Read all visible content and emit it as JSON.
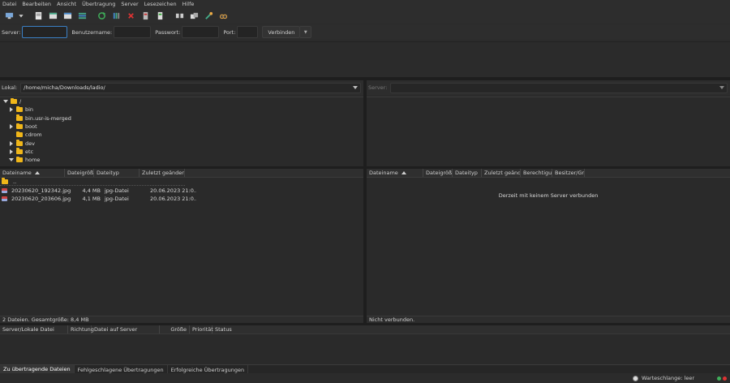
{
  "menu": [
    "Datei",
    "Bearbeiten",
    "Ansicht",
    "Übertragung",
    "Server",
    "Lesezeichen",
    "Hilfe"
  ],
  "toolbar_icons": [
    "site-manager-icon",
    "dropdown-arrow-icon",
    "toggle-log-icon",
    "toggle-local-tree-icon",
    "toggle-remote-tree-icon",
    "toggle-queue-icon",
    "refresh-icon",
    "process-queue-icon",
    "cancel-icon",
    "disconnect-icon",
    "reconnect-icon",
    "directory-compare-icon",
    "sync-browse-icon",
    "filter-icon",
    "search-icon"
  ],
  "quickconnect": {
    "server_label": "Server:",
    "server_value": "",
    "user_label": "Benutzername:",
    "user_value": "",
    "pass_label": "Passwort:",
    "pass_value": "",
    "port_label": "Port:",
    "port_value": "",
    "connect_label": "Verbinden"
  },
  "local": {
    "label": "Lokal:",
    "path": "/home/micha/Downloads/ladio/",
    "tree": [
      {
        "name": "/",
        "level": 0,
        "state": "expanded"
      },
      {
        "name": "bin",
        "level": 1,
        "state": "collapsed"
      },
      {
        "name": "bin.usr-is-merged",
        "level": 1,
        "state": "none"
      },
      {
        "name": "boot",
        "level": 1,
        "state": "collapsed"
      },
      {
        "name": "cdrom",
        "level": 1,
        "state": "none"
      },
      {
        "name": "dev",
        "level": 1,
        "state": "collapsed"
      },
      {
        "name": "etc",
        "level": 1,
        "state": "collapsed"
      },
      {
        "name": "home",
        "level": 1,
        "state": "expanded"
      }
    ],
    "columns": [
      "Dateiname",
      "Dateigröße",
      "Dateityp",
      "Zuletzt geändert"
    ],
    "parent_row": "..",
    "files": [
      {
        "name": "20230620_192342.jpg",
        "size": "4,4 MB",
        "type": "jpg-Datei",
        "modified": "20.06.2023 21:0..."
      },
      {
        "name": "20230620_203606.jpg",
        "size": "4,1 MB",
        "type": "jpg-Datei",
        "modified": "20.06.2023 21:0..."
      }
    ],
    "status": "2 Dateien. Gesamtgröße: 8,4 MB"
  },
  "remote": {
    "label": "Server:",
    "path": "",
    "columns": [
      "Dateiname",
      "Dateigröße",
      "Dateityp",
      "Zuletzt geänder",
      "Berechtigun",
      "Besitzer/Grup"
    ],
    "empty_message": "Derzeit mit keinem Server verbunden",
    "status": "Nicht verbunden."
  },
  "queue": {
    "columns": [
      "Server/Lokale Datei",
      "Richtung",
      "Datei auf Server",
      "Größe",
      "Priorität",
      "Status"
    ],
    "tabs": [
      "Zu übertragende Dateien",
      "Fehlgeschlagene Übertragungen",
      "Erfolgreiche Übertragungen"
    ],
    "queue_status": "Warteschlange: leer"
  },
  "colors": {
    "accent": "#3b7fc4",
    "folder": "#f0b619",
    "background": "#2b2b2b"
  }
}
